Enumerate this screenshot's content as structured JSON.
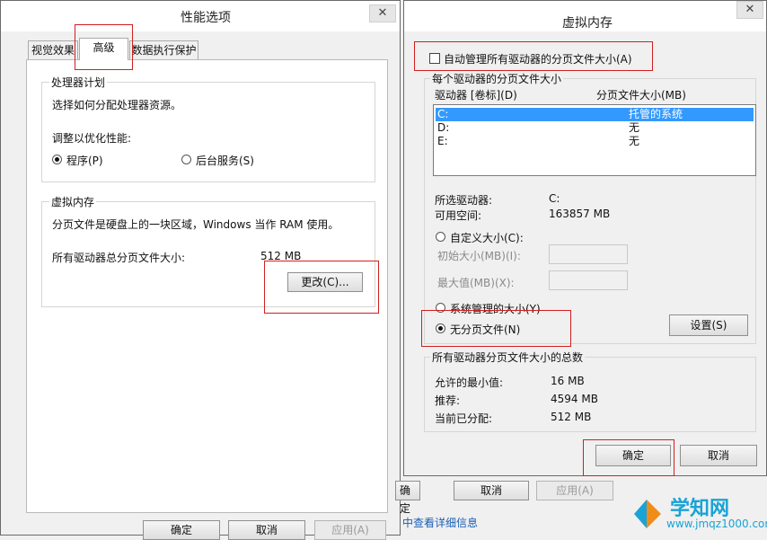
{
  "perf": {
    "title": "性能选项",
    "tabs": [
      "视觉效果",
      "高级",
      "数据执行保护"
    ],
    "processor": {
      "group_label": "处理器计划",
      "desc": "选择如何分配处理器资源。",
      "adjust": "调整以优化性能:",
      "opt_programs": "程序(P)",
      "opt_services": "后台服务(S)"
    },
    "vm": {
      "group_label": "虚拟内存",
      "desc": "分页文件是硬盘上的一块区域，Windows 当作 RAM 使用。",
      "total_label": "所有驱动器总分页文件大小:",
      "total_value": "512 MB",
      "change_button": "更改(C)..."
    },
    "buttons": {
      "ok": "确定",
      "cancel": "取消",
      "apply": "应用(A)"
    }
  },
  "back": {
    "ok": "确定",
    "cancel": "取消",
    "apply": "应用(A)",
    "link": "中查看详细信息"
  },
  "vmdlg": {
    "title": "虚拟内存",
    "auto_manage": "自动管理所有驱动器的分页文件大小(A)",
    "per_drive_label": "每个驱动器的分页文件大小",
    "col_drive": "驱动器 [卷标](D)",
    "col_size": "分页文件大小(MB)",
    "drives": [
      {
        "drive": "C:",
        "size": "托管的系统"
      },
      {
        "drive": "D:",
        "size": "无"
      },
      {
        "drive": "E:",
        "size": "无"
      }
    ],
    "selected_drive_label": "所选驱动器:",
    "selected_drive_value": "C:",
    "free_space_label": "可用空间:",
    "free_space_value": "163857 MB",
    "custom_size": "自定义大小(C):",
    "initial_size": "初始大小(MB)(I):",
    "max_size": "最大值(MB)(X):",
    "system_managed": "系统管理的大小(Y)",
    "no_paging": "无分页文件(N)",
    "set_button": "设置(S)",
    "totals_label": "所有驱动器分页文件大小的总数",
    "min_label": "允许的最小值:",
    "min_value": "16 MB",
    "recommended_label": "推荐:",
    "recommended_value": "4594 MB",
    "allocated_label": "当前已分配:",
    "allocated_value": "512 MB",
    "ok": "确定",
    "cancel": "取消"
  },
  "watermark": {
    "brand": "学知网",
    "url": "www.jmqz1000.com"
  },
  "colors": {
    "highlight": "#3399ff",
    "annotation": "#d01f1f",
    "watermark": "#1aa3d6"
  }
}
